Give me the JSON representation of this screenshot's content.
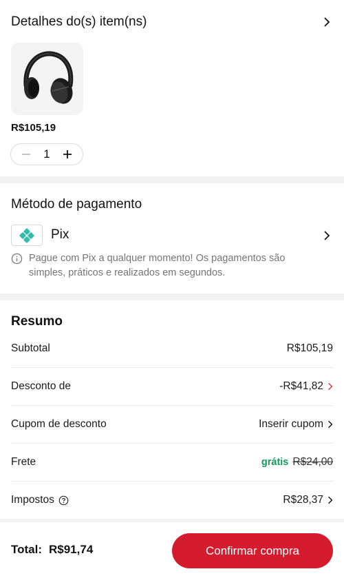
{
  "items_section": {
    "title": "Detalhes do(s) item(ns)",
    "product": {
      "image": "black-wireless-headphones",
      "price": "R$105,19",
      "quantity": "1",
      "minus_icon": "minus-icon",
      "plus_icon": "plus-icon"
    }
  },
  "payment_section": {
    "title": "Método de pagamento",
    "method": "Pix",
    "method_icon": "pix-icon",
    "info_text": "Pague com Pix a qualquer momento! Os pagamentos são simples, práticos e realizados em segundos."
  },
  "summary": {
    "title": "Resumo",
    "subtotal": {
      "label": "Subtotal",
      "value": "R$105,19"
    },
    "discount": {
      "label": "Desconto de",
      "value": "-R$41,82"
    },
    "coupon": {
      "label": "Cupom de desconto",
      "value": "Inserir cupom"
    },
    "shipping": {
      "label": "Frete",
      "free_label": "grátis",
      "original": "R$24,00"
    },
    "taxes": {
      "label": "Impostos",
      "value": "R$28,37"
    }
  },
  "footer": {
    "total_label": "Total:",
    "total_value": "R$91,74",
    "confirm_label": "Confirmar compra"
  },
  "colors": {
    "accent": "#d51b2e",
    "discount": "#e0343c",
    "free": "#169b5b",
    "pix": "#32bcad"
  }
}
